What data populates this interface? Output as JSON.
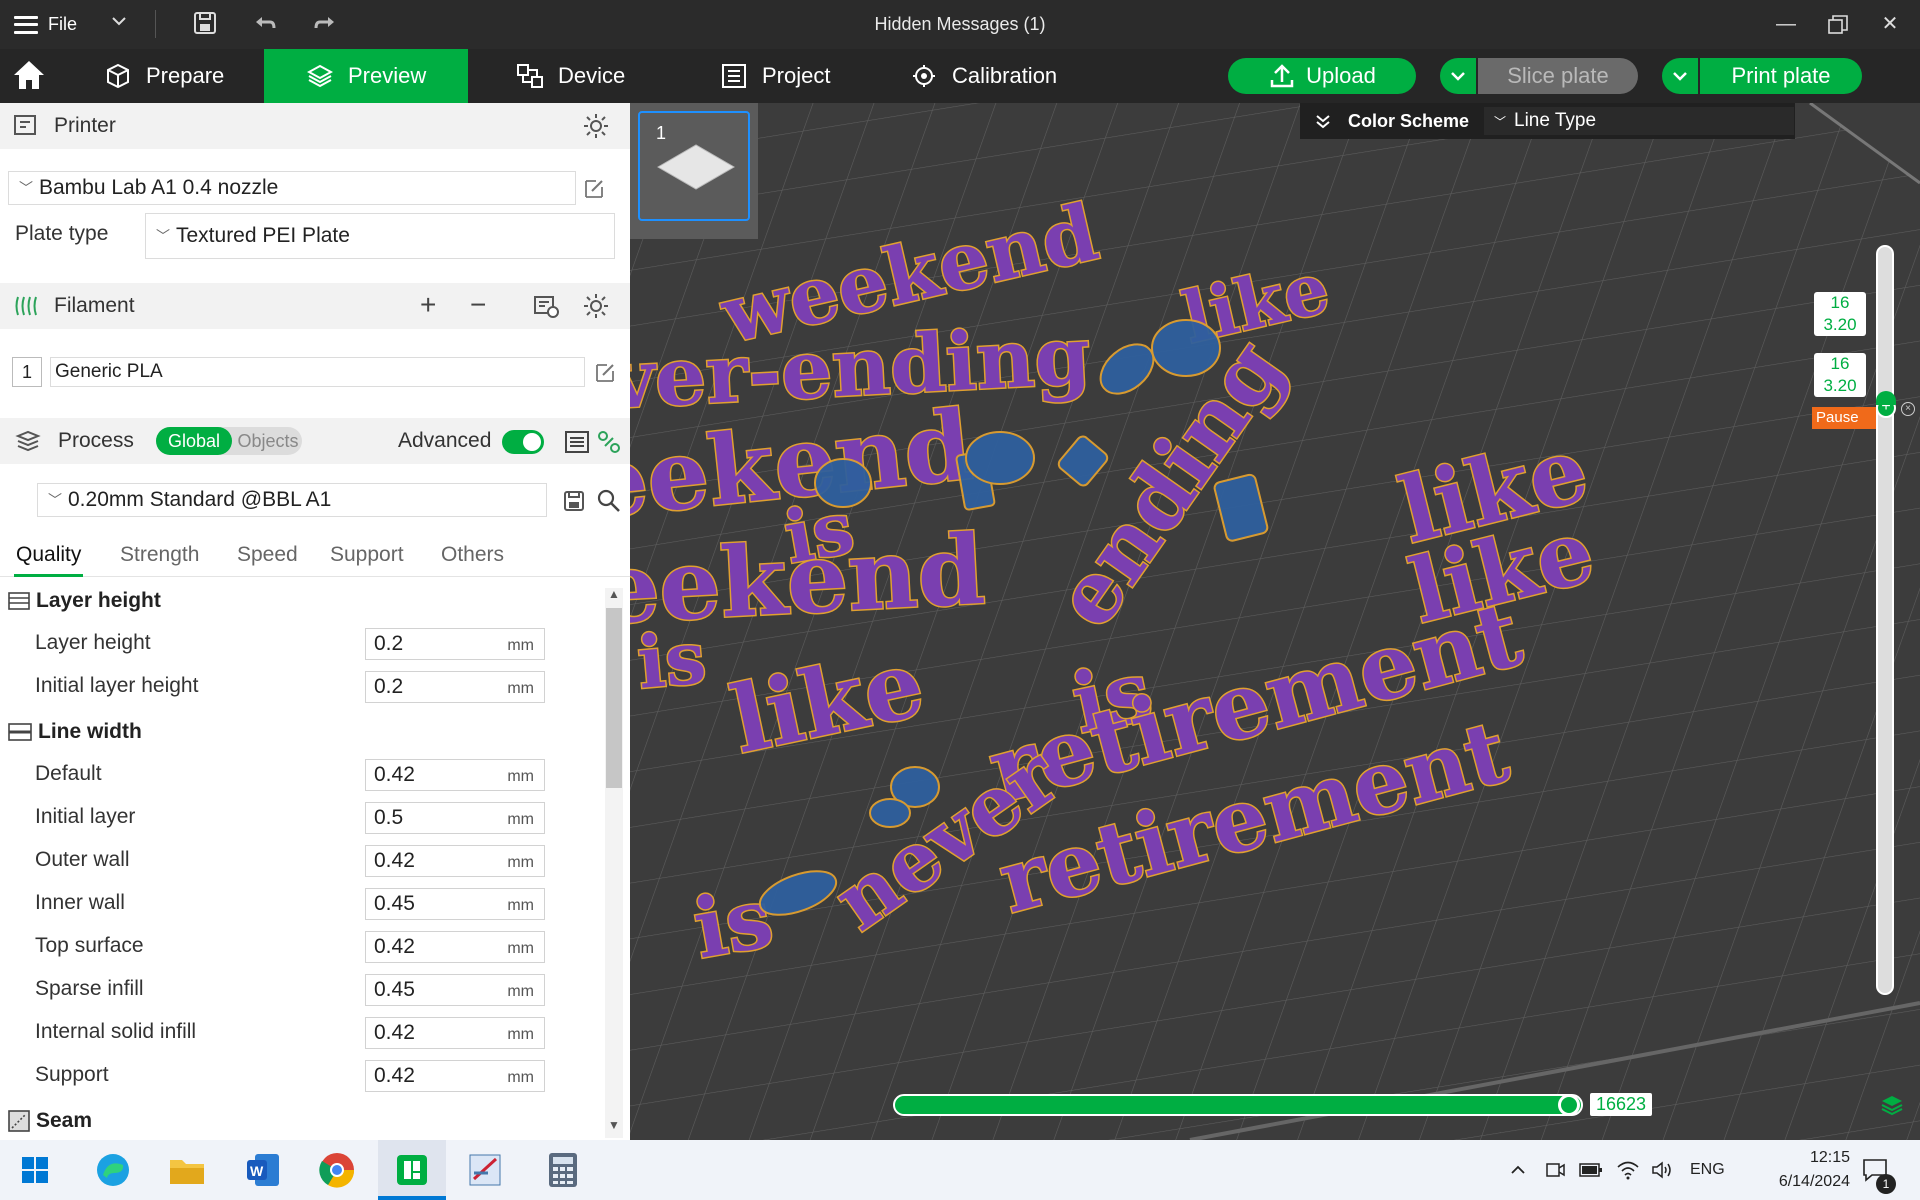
{
  "window": {
    "title": "Hidden Messages (1)",
    "file_label": "File"
  },
  "nav": {
    "tabs": [
      {
        "label": "Prepare"
      },
      {
        "label": "Preview"
      },
      {
        "label": "Device"
      },
      {
        "label": "Project"
      },
      {
        "label": "Calibration"
      }
    ],
    "upload_label": "Upload",
    "slice_label": "Slice plate",
    "print_label": "Print plate"
  },
  "printer": {
    "section_label": "Printer",
    "model": "Bambu Lab A1 0.4 nozzle",
    "plate_type_label": "Plate type",
    "plate_type": "Textured PEI Plate"
  },
  "filament": {
    "section_label": "Filament",
    "slot": "1",
    "name": "Generic PLA"
  },
  "process": {
    "section_label": "Process",
    "global_label": "Global",
    "objects_label": "Objects",
    "advanced_label": "Advanced",
    "advanced_on": true,
    "profile": "0.20mm Standard @BBL A1",
    "tabs": [
      "Quality",
      "Strength",
      "Speed",
      "Support",
      "Others"
    ],
    "active_tab": "Quality"
  },
  "settings": {
    "layer_height_group": "Layer height",
    "line_width_group": "Line width",
    "seam_group": "Seam",
    "unit": "mm",
    "layer_height": [
      {
        "label": "Layer height",
        "value": "0.2"
      },
      {
        "label": "Initial layer height",
        "value": "0.2"
      }
    ],
    "line_width": [
      {
        "label": "Default",
        "value": "0.42"
      },
      {
        "label": "Initial layer",
        "value": "0.5"
      },
      {
        "label": "Outer wall",
        "value": "0.42"
      },
      {
        "label": "Inner wall",
        "value": "0.45"
      },
      {
        "label": "Top surface",
        "value": "0.42"
      },
      {
        "label": "Sparse infill",
        "value": "0.45"
      },
      {
        "label": "Internal solid infill",
        "value": "0.42"
      },
      {
        "label": "Support",
        "value": "0.42"
      }
    ]
  },
  "viewport": {
    "plate_number": "1",
    "color_scheme_label": "Color Scheme",
    "color_scheme_value": "Line Type",
    "layer_top": {
      "num": "16",
      "height": "3.20"
    },
    "layer_bottom": {
      "num": "16",
      "height": "3.20"
    },
    "pause_label": "Pause",
    "move_value": "16623",
    "print_text_lines": [
      "weekend",
      "like",
      "ver-ending",
      "eekend",
      "is",
      "eekend",
      "is",
      "like",
      "is",
      "retirement",
      "is",
      "retirement",
      "ending",
      "like",
      "like",
      "never"
    ]
  },
  "taskbar": {
    "lang": "ENG",
    "time": "12:15",
    "date": "6/14/2024",
    "notif_count": "1"
  },
  "colors": {
    "accent": "#00ae42",
    "print_purple": "#7a3fb0",
    "print_orange": "#f0a020",
    "print_blue": "#2f5f9e"
  }
}
